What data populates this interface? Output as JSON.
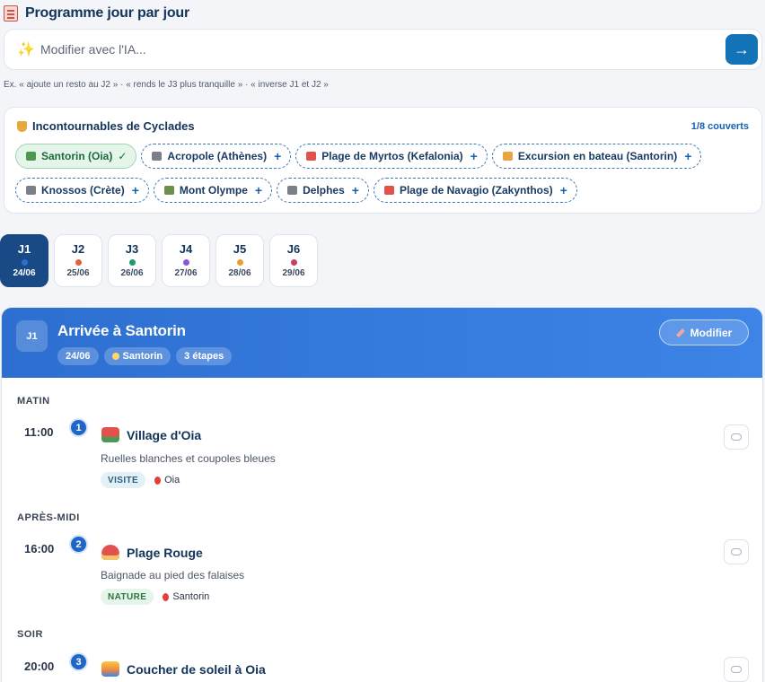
{
  "header": {
    "title": "Programme jour par jour",
    "icon": "notepad-icon"
  },
  "ai": {
    "placeholder": "Modifier avec l'IA...",
    "spark_icon": "sparkle-icon",
    "send_icon": "→",
    "hint": "Ex. « ajoute un resto au J2 » · « rends le J3 plus tranquille » · « inverse J1 et J2 »"
  },
  "must": {
    "title": "Incontournables de Cyclades",
    "count": "1/8 couverts",
    "chips": [
      {
        "label": "Santorin (Oia)",
        "done": true,
        "icon": "palm-icon",
        "color": "#4c9a52"
      },
      {
        "label": "Acropole (Athènes)",
        "done": false,
        "icon": "temple-icon",
        "color": "#7b7f88"
      },
      {
        "label": "Plage de Myrtos (Kefalonia)",
        "done": false,
        "icon": "beach-icon",
        "color": "#e0524b"
      },
      {
        "label": "Excursion en bateau (Santorin)",
        "done": false,
        "icon": "boat-icon",
        "color": "#e8a440"
      },
      {
        "label": "Knossos (Crète)",
        "done": false,
        "icon": "temple-icon",
        "color": "#7b7f88"
      },
      {
        "label": "Mont Olympe",
        "done": false,
        "icon": "mountain-icon",
        "color": "#6b8f4e"
      },
      {
        "label": "Delphes",
        "done": false,
        "icon": "temple-icon",
        "color": "#7b7f88"
      },
      {
        "label": "Plage de Navagio (Zakynthos)",
        "done": false,
        "icon": "beach-icon",
        "color": "#e0524b"
      }
    ],
    "plus": "+",
    "check": "✓"
  },
  "days": [
    {
      "label": "J1",
      "date": "24/06",
      "dot": "#2d6fd1",
      "active": true
    },
    {
      "label": "J2",
      "date": "25/06",
      "dot": "#e0613a",
      "active": false
    },
    {
      "label": "J3",
      "date": "26/06",
      "dot": "#1f9a6a",
      "active": false
    },
    {
      "label": "J4",
      "date": "27/06",
      "dot": "#8a55d8",
      "active": false
    },
    {
      "label": "J5",
      "date": "28/06",
      "dot": "#e3a12b",
      "active": false
    },
    {
      "label": "J6",
      "date": "29/06",
      "dot": "#c93f5f",
      "active": false
    }
  ],
  "day": {
    "badge": "J1",
    "title": "Arrivée à Santorin",
    "date": "24/06",
    "place": "Santorin",
    "steps_count": "3 étapes",
    "edit": "Modifier",
    "periods": {
      "matin": "MATIN",
      "aprem": "APRÈS-MIDI",
      "soir": "SOIR"
    },
    "steps": [
      {
        "time": "11:00",
        "num": "1",
        "title": "Village d'Oia",
        "desc": "Ruelles blanches et coupoles bleues",
        "cat": "VISITE",
        "loc": "Oia",
        "icon": "village-icon",
        "icon_color": "#e0524b"
      },
      {
        "time": "16:00",
        "num": "2",
        "title": "Plage Rouge",
        "desc": "Baignade au pied des falaises",
        "cat": "NATURE",
        "loc": "Santorin",
        "icon": "beach-icon",
        "icon_color": "#e0524b"
      },
      {
        "time": "20:00",
        "num": "3",
        "title": "Coucher de soleil à Oia",
        "icon": "sunset-icon",
        "icon_color": "#f08a3c"
      }
    ]
  }
}
